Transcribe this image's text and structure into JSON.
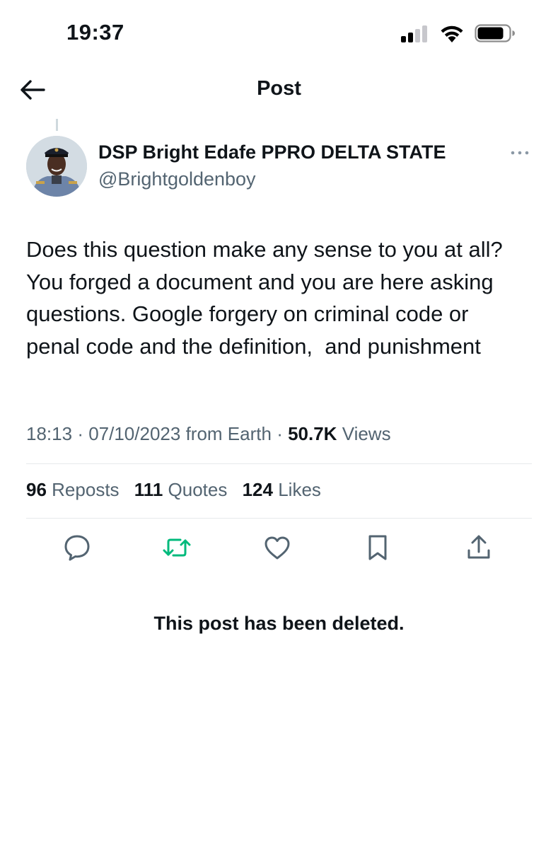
{
  "status_bar": {
    "time": "19:37",
    "signal_icon": "cellular-signal-icon",
    "wifi_icon": "wifi-icon",
    "battery_icon": "battery-icon"
  },
  "header": {
    "title": "Post",
    "back_icon": "arrow-left-icon"
  },
  "post": {
    "author_name": "DSP Bright Edafe PPRO DELTA STATE",
    "author_handle": "@Brightgoldenboy",
    "text": "Does this question make any sense to you at all? You forged a document and you are here asking questions. Google forgery on criminal code or penal code and the definition,  and punishment",
    "time": "18:13",
    "date": "07/10/2023",
    "location": "from Earth",
    "views_count": "50.7K",
    "views_label": "Views",
    "more_icon": "more-horizontal-icon"
  },
  "stats": {
    "reposts_count": "96",
    "reposts_label": "Reposts",
    "quotes_count": "111",
    "quotes_label": "Quotes",
    "likes_count": "124",
    "likes_label": "Likes"
  },
  "actions": {
    "reply_icon": "reply-icon",
    "repost_icon": "repost-icon",
    "like_icon": "heart-icon",
    "bookmark_icon": "bookmark-icon",
    "share_icon": "share-icon"
  },
  "deleted_notice": "This post has been deleted.",
  "colors": {
    "text_primary": "#0f1419",
    "text_secondary": "#536471",
    "divider": "#e6e9eb",
    "repost_active": "#00ba7c",
    "icon_gray": "#536471"
  }
}
